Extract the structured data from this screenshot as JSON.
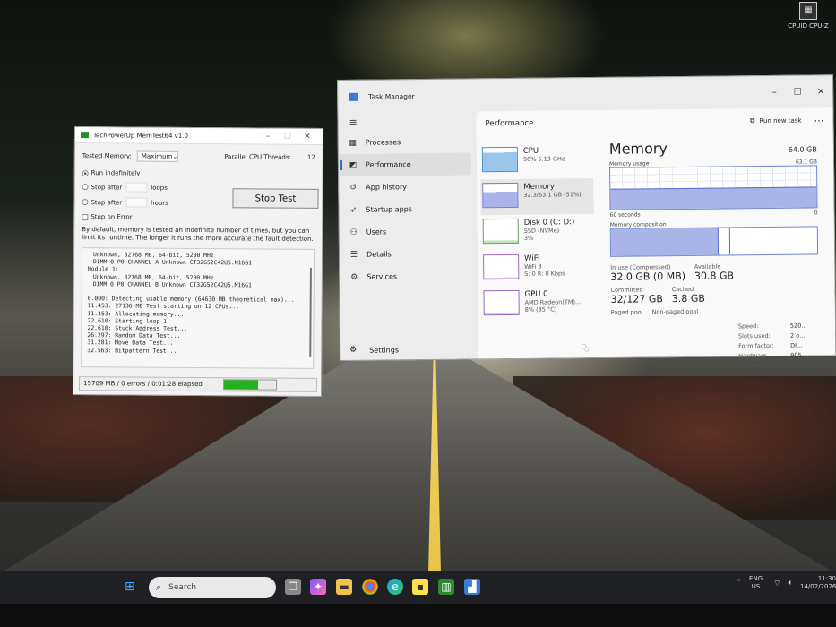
{
  "desktop": {
    "icon_label": "CPUID CPU-Z"
  },
  "memtest": {
    "title": "TechPowerUp MemTest64 v1.0",
    "tested_memory_label": "Tested Memory:",
    "tested_memory_value": "Maximum",
    "parallel_label": "Parallel CPU Threads:",
    "parallel_value": "12",
    "run_indefinitely": "Run indefinitely",
    "stop_after_1": "Stop after",
    "loops": "loops",
    "stop_after_2": "Stop after",
    "hours": "hours",
    "stop_on_error": "Stop on Error",
    "stop_button": "Stop Test",
    "description": "By default, memory is tested an indefinite number of times, but you can limit its runtime. The longer it runs the more accurate the fault detection.",
    "log_lines": [
      "Unknown, 32768 MB, 64-bit, 5200 MHz",
      "DIMM 0 P0 CHANNEL A Unknown CT32G52C42U5.M16G1",
      "Module 1:",
      "Unknown, 32768 MB, 64-bit, 5200 MHz",
      "DIMM 0 P0 CHANNEL B Unknown CT32G52C42U5.M16G1",
      "",
      "0.000: Detecting usable memory (64630 MB theoretical max)...",
      "11.453: 27136 MB Test starting on 12 CPUs...",
      "11.453: Allocating memory...",
      "22.610: Starting loop 1",
      "22.610: Stuck Address Test...",
      "26.297: Random Data Test...",
      "31.281: Move Data Test...",
      "32.563: Bitpattern Test..."
    ],
    "status": "15709 MB / 0 errors / 0:01:28 elapsed",
    "progress_fraction": 0.65
  },
  "taskmanager": {
    "title": "Task Manager",
    "nav": {
      "processes": "Processes",
      "performance": "Performance",
      "app_history": "App history",
      "startup_apps": "Startup apps",
      "users": "Users",
      "details": "Details",
      "services": "Services",
      "settings": "Settings"
    },
    "perf_title": "Performance",
    "run_new_task": "Run new task",
    "devices": [
      {
        "name": "CPU",
        "sub1": "98%  5.13 GHz",
        "sub2": ""
      },
      {
        "name": "Memory",
        "sub1": "32.3/63.1 GB (51%)",
        "sub2": ""
      },
      {
        "name": "Disk 0 (C: D:)",
        "sub1": "SSD (NVMe)",
        "sub2": "3%"
      },
      {
        "name": "WiFi",
        "sub1": "WiFi 3",
        "sub2": "S: 0  R: 0 Kbps"
      },
      {
        "name": "GPU 0",
        "sub1": "AMD Radeon(TM)...",
        "sub2": "8%  (35 °C)"
      }
    ],
    "memory": {
      "heading": "Memory",
      "capacity": "64.0 GB",
      "usage_label": "Memory usage",
      "usage_max": "63.1 GB",
      "seconds_label": "60 seconds",
      "zero": "0",
      "usage_fraction": 0.51,
      "composition_label": "Memory composition",
      "in_use_label": "In use (Compressed)",
      "in_use_value": "32.0 GB (0 MB)",
      "available_label": "Available",
      "available_value": "30.8 GB",
      "committed_label": "Committed",
      "committed_value": "32/127 GB",
      "cached_label": "Cached",
      "cached_value": "3.8 GB",
      "paged_pool_label": "Paged pool",
      "nonpaged_pool_label": "Non-paged pool",
      "speed_label": "Speed:",
      "speed_value": "520...",
      "slots_label": "Slots used:",
      "slots_value": "2 o...",
      "form_label": "Form factor:",
      "form_value": "DI...",
      "reserved_label": "Hardware reserved:",
      "reserved_value": "905..."
    }
  },
  "taskbar": {
    "search_placeholder": "Search",
    "lang_line1": "ENG",
    "lang_line2": "US",
    "time": "11:30",
    "date": "14/02/2026"
  }
}
